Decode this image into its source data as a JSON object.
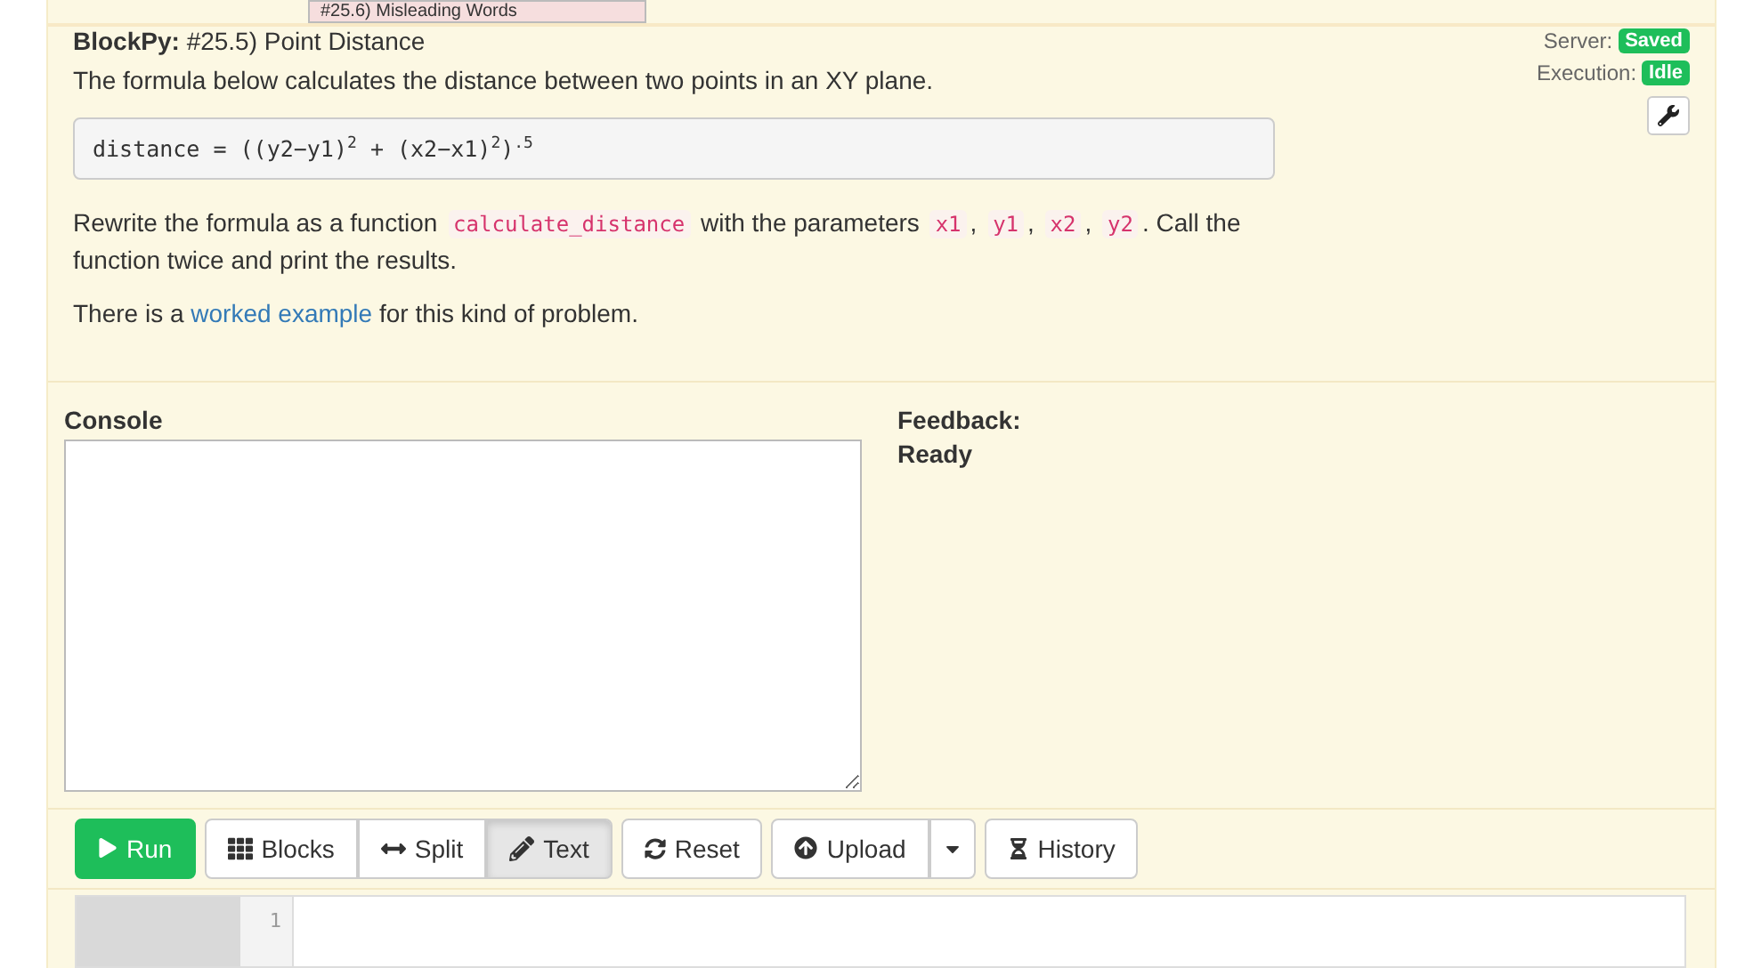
{
  "tooltip": "#25.6) Misleading Words",
  "header": {
    "brand": "BlockPy:",
    "title": "#25.5) Point Distance"
  },
  "status": [
    {
      "label": "Server:",
      "badge": "Saved"
    },
    {
      "label": "Execution:",
      "badge": "Idle"
    }
  ],
  "intro": "The formula below calculates the distance between two points in an XY plane.",
  "formula": "distance = ((y2−y1)$^{2}$ + (x2−x1)$^{2}$)$^{.5}$",
  "instructions": [
    {
      "kind": "text",
      "text": "Rewrite the formula as a function"
    },
    {
      "kind": "code",
      "text": "calculate_distance"
    },
    {
      "kind": "text",
      "text": "with the parameters"
    },
    {
      "kind": "code",
      "text": "x1"
    },
    {
      "kind": "text",
      "text": ","
    },
    {
      "kind": "code",
      "text": "y1"
    },
    {
      "kind": "text",
      "text": ","
    },
    {
      "kind": "code",
      "text": "x2"
    },
    {
      "kind": "text",
      "text": ","
    },
    {
      "kind": "code",
      "text": "y2"
    },
    {
      "kind": "text",
      "text": ". Call the function twice and print the results."
    }
  ],
  "example": [
    {
      "kind": "text",
      "text": "There is a"
    },
    {
      "kind": "link",
      "text": "worked example"
    },
    {
      "kind": "text",
      "text": "for this kind of problem."
    }
  ],
  "console": {
    "label": "Console"
  },
  "feedback": {
    "label": "Feedback:",
    "message": "Ready"
  },
  "toolbar": {
    "run": "Run",
    "modes": [
      {
        "label": "Blocks",
        "selected": false
      },
      {
        "label": "Split",
        "selected": false
      },
      {
        "label": "Text",
        "selected": true
      }
    ],
    "reset": "Reset",
    "upload": "Upload",
    "history": "History"
  },
  "editor": {
    "line_numbers": [
      "1"
    ]
  }
}
